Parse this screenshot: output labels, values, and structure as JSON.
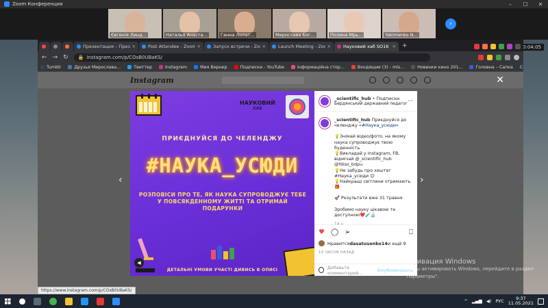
{
  "zoom": {
    "title": "Zoom Конференция",
    "participants": [
      {
        "name": "Євгенія Линд...",
        "skin": "#d8b49a",
        "bg": "#c9c0b5"
      },
      {
        "name": "Наталья Анаста...",
        "skin": "#e3c2a8",
        "bg": "#a89f95"
      },
      {
        "name": "Ганна Лопат...",
        "skin": "#d9ae90",
        "bg": "#8a7a6a"
      },
      {
        "name": "Мирослава Бог...",
        "skin": "#e6c7b2",
        "bg": "#b8aaa0"
      },
      {
        "name": "Полина Мрь...",
        "skin": "#e9c9b5",
        "bg": "#ddd3cc"
      },
      {
        "name": "Yakimenko N...",
        "skin": "#d4a88c",
        "bg": "#cbbdb5"
      }
    ],
    "timer": "00:04:05"
  },
  "browser": {
    "tabs": [
      {
        "label": "",
        "color": "#ff4444",
        "small": true
      },
      {
        "label": "",
        "color": "#888888",
        "small": true
      },
      {
        "label": "",
        "color": "#ff7043",
        "small": true
      },
      {
        "label": "Презентация – Презентация",
        "color": "#2d8cff"
      },
      {
        "label": "Post Attendee - Zoom",
        "color": "#2d8cff"
      },
      {
        "label": "Запуск встречи - Zoom",
        "color": "#2d8cff"
      },
      {
        "label": "Launch Meeting - Zoom",
        "color": "#2d8cff"
      },
      {
        "label": "Науковий хаб SO16",
        "color": "#c13584",
        "active": true
      }
    ],
    "url": "instagram.com/p/COsB0UBaKS/",
    "bookmarks": [
      {
        "label": "Tumblr",
        "color": "#36465d"
      },
      {
        "label": "Друзья Мирослава...",
        "color": "#4a76a8"
      },
      {
        "label": "Твиттер",
        "color": "#1da1f2"
      },
      {
        "label": "Instagram",
        "color": "#c13584"
      },
      {
        "label": "Мия Вернер",
        "color": "#1877f2"
      },
      {
        "label": "Подписки - YouTube",
        "color": "#ff0000"
      },
      {
        "label": "Інформаційна стор...",
        "color": "#e94e77"
      },
      {
        "label": "Входящие (3) - mis...",
        "color": "#ea4335"
      },
      {
        "label": "Новинки кино 201...",
        "color": "#555555"
      },
      {
        "label": "Головна – Сапка",
        "color": "#3b5bdb"
      }
    ],
    "reading_list": "Список для чтения",
    "status_url": "https://www.instagram.com/p/COsB0UBaKS/"
  },
  "instagram": {
    "logo": "Instagram",
    "post_image": {
      "hub_line1": "НАУКОВИЙ",
      "hub_line2": "ХАБ",
      "challenge": "ПРИЄДНУЙСЯ ДО ЧЕЛЕНДЖУ",
      "hashtag": "#НАУКА_УСЮДИ",
      "description": "РОЗПОВІСИ ПРО ТЕ, ЯК НАУКА СУПРОВОДЖУЄ ТЕБЕ У ПОВСЯКДЕННОМУ ЖИТТІ ТА ОТРИМАЙ ПОДАРУНКИ",
      "footnote": "ДЕТАЛЬНІ УМОВИ УЧАСТІ ДИВИСЬ В ОПИСІ"
    },
    "post": {
      "username": "_scientific_hub",
      "follow": "• Подписки",
      "location": "Бердянський державний педагогічний уні...",
      "caption_intro": "Приєднуйся до челенджу «",
      "caption_tag": "#Наука_усюди",
      "caption_intro_end": "»",
      "lines": [
        "💡Знімай відео/фото, на якому наука супроводжує твою буденність",
        "💡Викладай у Instagram, FB, відмічай @_scientific_hub @fdiso_bdpu",
        "💡Не забудь про хештег #Наука_усюди 😉",
        "💡Найкращі світлини отримають 🎁"
      ],
      "results": "🚀 Результати вже 31 травня",
      "closing": "Зробимо науку цікавою та доступною❤️🧪🔬",
      "time": "14 ч.",
      "likes_prefix": "Нравится ",
      "likes_user": "dasatusenko14",
      "likes_suffix": " и ещё 9",
      "ago": "14 ЧАСОВ НАЗАД",
      "comment_placeholder": "Добавьте комментарий...",
      "publish": "Опубликовать"
    }
  },
  "windows": {
    "activation_title": "Активация Windows",
    "activation_text": "Чтобы активировать Windows, перейдите в раздел \"Параметры\".",
    "lang": "РУС",
    "time": "9:37",
    "date": "11.05.2021"
  }
}
